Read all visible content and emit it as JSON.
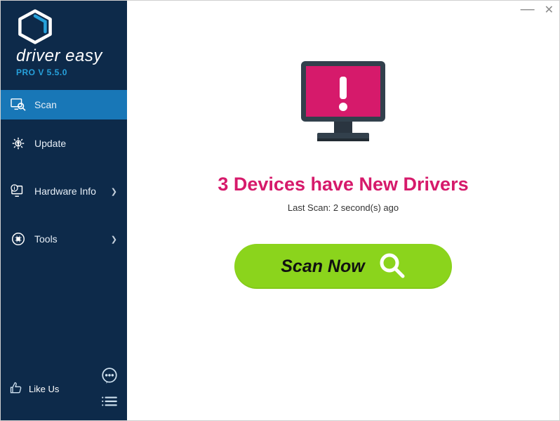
{
  "brand": {
    "name": "driver easy",
    "version": "PRO V 5.5.0"
  },
  "sidebar": {
    "items": [
      {
        "label": "Scan"
      },
      {
        "label": "Update"
      },
      {
        "label": "Hardware Info"
      },
      {
        "label": "Tools"
      }
    ],
    "like_label": "Like Us"
  },
  "main": {
    "status_title": "3 Devices have New Drivers",
    "last_scan": "Last Scan: 2 second(s) ago",
    "scan_button_label": "Scan Now"
  },
  "colors": {
    "accent": "#1877b7",
    "alert": "#d61a6b",
    "action": "#8bd41c",
    "sidebar_bg": "#0d2a4a"
  }
}
